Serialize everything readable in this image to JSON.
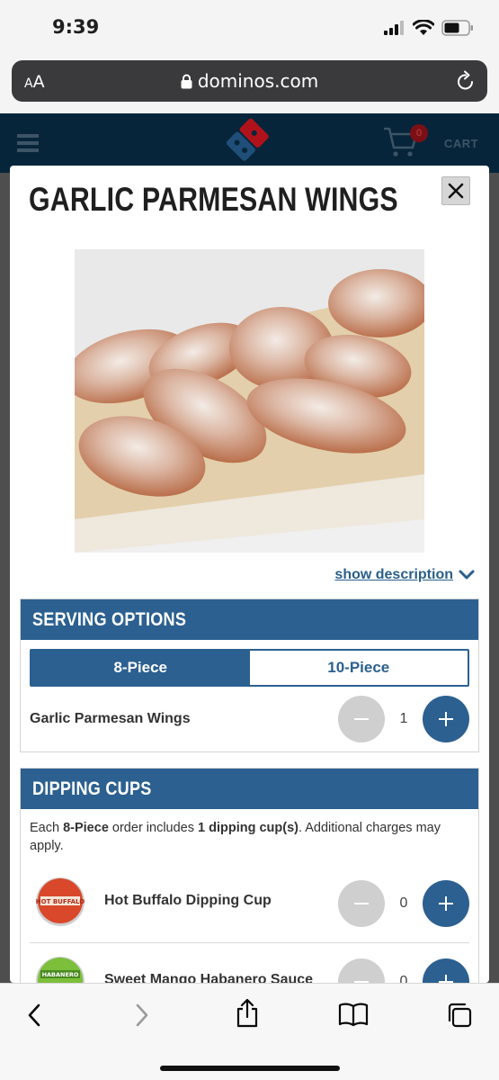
{
  "status_bar": {
    "time": "9:39"
  },
  "browser": {
    "aa_label_big": "A",
    "aa_label_small": "A",
    "url": "dominos.com"
  },
  "header": {
    "cart_count": "0",
    "cart_label": "CART"
  },
  "modal": {
    "title": "GARLIC PARMESAN WINGS",
    "show_description": "show description",
    "serving_options": {
      "heading": "SERVING OPTIONS",
      "options": [
        "8-Piece",
        "10-Piece"
      ],
      "selected": "8-Piece",
      "item_label": "Garlic Parmesan Wings",
      "quantity": "1"
    },
    "dipping_cups": {
      "heading": "DIPPING CUPS",
      "note_pre": "Each ",
      "note_piece": "8-Piece",
      "note_mid": " order includes ",
      "note_cups": "1 dipping cup(s)",
      "note_post": ". Additional charges may apply.",
      "items": [
        {
          "name": "Hot Buffalo Dipping Cup",
          "quantity": "0",
          "cup_text": "HOT BUFFALO",
          "cup_color": "#d9482b"
        },
        {
          "name": "Sweet Mango Habanero Sauce",
          "quantity": "0",
          "cup_text": "HABANERO",
          "cup_color": "#7bbf3a"
        }
      ]
    }
  },
  "colors": {
    "brand_blue": "#2c6090",
    "header_navy": "#06253a",
    "disabled_gray": "#cfcfcf"
  }
}
